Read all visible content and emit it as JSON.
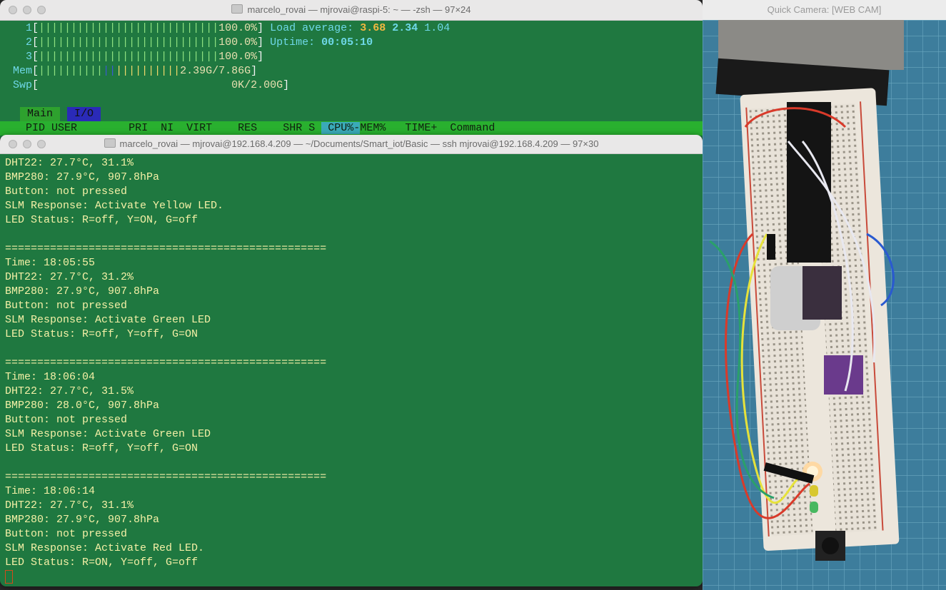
{
  "htop_window": {
    "title": "marcelo_rovai — mjrovai@raspi-5: ~ — -zsh — 97×24",
    "cpus": [
      {
        "num": "1",
        "bars": "||||||||||||||||||||||||||||",
        "percent": "100.0%"
      },
      {
        "num": "2",
        "bars": "||||||||||||||||||||||||||||",
        "percent": "100.0%"
      },
      {
        "num": "3",
        "bars": "||||||||||||||||||||||||||||",
        "percent": "100.0%"
      }
    ],
    "mem": {
      "label": "Mem",
      "bars_green": "||||||||||",
      "bars_blue": "||",
      "bars_yellow": "||||||||||",
      "value": "2.39G/7.86G"
    },
    "swp": {
      "label": "Swp",
      "value": "0K/2.00G"
    },
    "load_average": {
      "label": "Load average:",
      "one": "3.68",
      "five": "2.34",
      "fifteen": "1.04"
    },
    "uptime": {
      "label": "Uptime:",
      "value": "00:05:10"
    },
    "tabs": [
      "Main",
      "I/O"
    ],
    "columns": {
      "pid": "PID",
      "user": "USER",
      "pri": "PRI",
      "ni": "NI",
      "virt": "VIRT",
      "res": "RES",
      "shr": "SHR",
      "s": "S",
      "cpu": "CPU%",
      "sep": "-",
      "mem": "MEM%",
      "time": "TIME+",
      "command": "Command"
    }
  },
  "ssh_window": {
    "title": "marcelo_rovai — mjrovai@192.168.4.209 — ~/Documents/Smart_iot/Basic — ssh mjrovai@192.168.4.209 — 97×30",
    "separator": "==================================================",
    "first_partial": [
      "DHT22: 27.7°C, 31.1%",
      "BMP280: 27.9°C, 907.8hPa",
      "Button: not pressed",
      "SLM Response: Activate Yellow LED.",
      "LED Status: R=off, Y=ON, G=off"
    ],
    "blocks": [
      {
        "time": "Time: 18:05:55",
        "dht": "DHT22: 27.7°C, 31.2%",
        "bmp": "BMP280: 27.9°C, 907.8hPa",
        "button": "Button: not pressed",
        "slm": "SLM Response: Activate Green LED",
        "led": "LED Status: R=off, Y=off, G=ON"
      },
      {
        "time": "Time: 18:06:04",
        "dht": "DHT22: 27.7°C, 31.5%",
        "bmp": "BMP280: 28.0°C, 907.8hPa",
        "button": "Button: not pressed",
        "slm": "SLM Response: Activate Green LED",
        "led": "LED Status: R=off, Y=off, G=ON"
      },
      {
        "time": "Time: 18:06:14",
        "dht": "DHT22: 27.7°C, 31.1%",
        "bmp": "BMP280: 27.9°C, 907.8hPa",
        "button": "Button: not pressed",
        "slm": "SLM Response: Activate Red LED.",
        "led": "LED Status: R=ON, Y=off, G=off"
      }
    ]
  },
  "camera_window": {
    "title": "Quick Camera: [WEB CAM]"
  },
  "colors": {
    "terminal_bg": "#1f7840",
    "terminal_text": "#f4f0a6",
    "htop_header": "#29b02f",
    "accent_cyan": "#6fd8e8",
    "load_highlight": "#f3b840"
  }
}
